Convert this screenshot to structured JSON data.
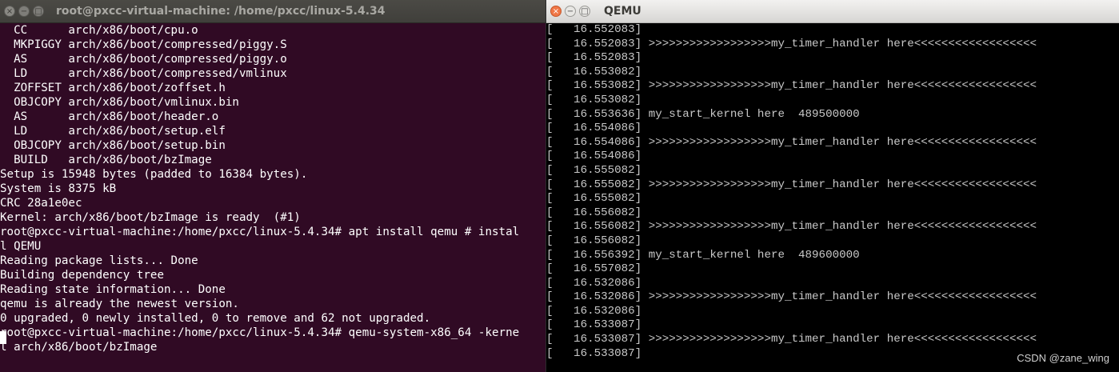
{
  "terminal": {
    "title": "root@pxcc-virtual-machine: /home/pxcc/linux-5.4.34",
    "lines": [
      "  CC      arch/x86/boot/cpu.o",
      "  MKPIGGY arch/x86/boot/compressed/piggy.S",
      "  AS      arch/x86/boot/compressed/piggy.o",
      "  LD      arch/x86/boot/compressed/vmlinux",
      "  ZOFFSET arch/x86/boot/zoffset.h",
      "  OBJCOPY arch/x86/boot/vmlinux.bin",
      "  AS      arch/x86/boot/header.o",
      "  LD      arch/x86/boot/setup.elf",
      "  OBJCOPY arch/x86/boot/setup.bin",
      "  BUILD   arch/x86/boot/bzImage",
      "Setup is 15948 bytes (padded to 16384 bytes).",
      "System is 8375 kB",
      "CRC 28a1e0ec",
      "Kernel: arch/x86/boot/bzImage is ready  (#1)",
      "root@pxcc-virtual-machine:/home/pxcc/linux-5.4.34# apt install qemu # instal",
      "l QEMU",
      "Reading package lists... Done",
      "Building dependency tree",
      "Reading state information... Done",
      "qemu is already the newest version.",
      "0 upgraded, 0 newly installed, 0 to remove and 62 not upgraded.",
      "root@pxcc-virtual-machine:/home/pxcc/linux-5.4.34# qemu-system-x86_64 -kerne",
      "l arch/x86/boot/bzImage"
    ],
    "colors": {
      "background": "#300a24",
      "text": "#ffffff"
    }
  },
  "qemu": {
    "title": "QEMU",
    "lines": [
      "[   16.552083]",
      "[   16.552083] >>>>>>>>>>>>>>>>>>my_timer_handler here<<<<<<<<<<<<<<<<<<",
      "[   16.552083]",
      "[   16.553082]",
      "[   16.553082] >>>>>>>>>>>>>>>>>>my_timer_handler here<<<<<<<<<<<<<<<<<<",
      "[   16.553082]",
      "[   16.553636] my_start_kernel here  489500000",
      "[   16.554086]",
      "[   16.554086] >>>>>>>>>>>>>>>>>>my_timer_handler here<<<<<<<<<<<<<<<<<<",
      "[   16.554086]",
      "[   16.555082]",
      "[   16.555082] >>>>>>>>>>>>>>>>>>my_timer_handler here<<<<<<<<<<<<<<<<<<",
      "[   16.555082]",
      "[   16.556082]",
      "[   16.556082] >>>>>>>>>>>>>>>>>>my_timer_handler here<<<<<<<<<<<<<<<<<<",
      "[   16.556082]",
      "[   16.556392] my_start_kernel here  489600000",
      "[   16.557082]",
      "[   16.532086]",
      "[   16.532086] >>>>>>>>>>>>>>>>>>my_timer_handler here<<<<<<<<<<<<<<<<<<",
      "[   16.532086]",
      "[   16.533087]",
      "[   16.533087] >>>>>>>>>>>>>>>>>>my_timer_handler here<<<<<<<<<<<<<<<<<<",
      "[   16.533087]"
    ],
    "colors": {
      "background": "#000000",
      "text": "#c8c8c8",
      "close_button": "#f07746"
    }
  },
  "window_buttons": {
    "close_icon": "×",
    "minimize_icon": "−",
    "maximize_icon": "□"
  },
  "watermark": "CSDN @zane_wing"
}
